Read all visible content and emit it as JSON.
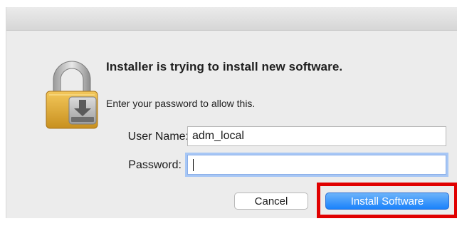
{
  "dialog": {
    "heading": "Installer is trying to install new software.",
    "prompt": "Enter your password to allow this.",
    "fields": {
      "username_label": "User Name:",
      "username_value": "adm_local",
      "password_label": "Password:",
      "password_value": ""
    },
    "buttons": {
      "cancel_label": "Cancel",
      "install_label": "Install Software"
    },
    "icon": "lock-installer-icon"
  },
  "colors": {
    "primary_button": "#1a82fb",
    "highlight_box": "#e00000",
    "focus_ring": "#a7c7f5"
  }
}
